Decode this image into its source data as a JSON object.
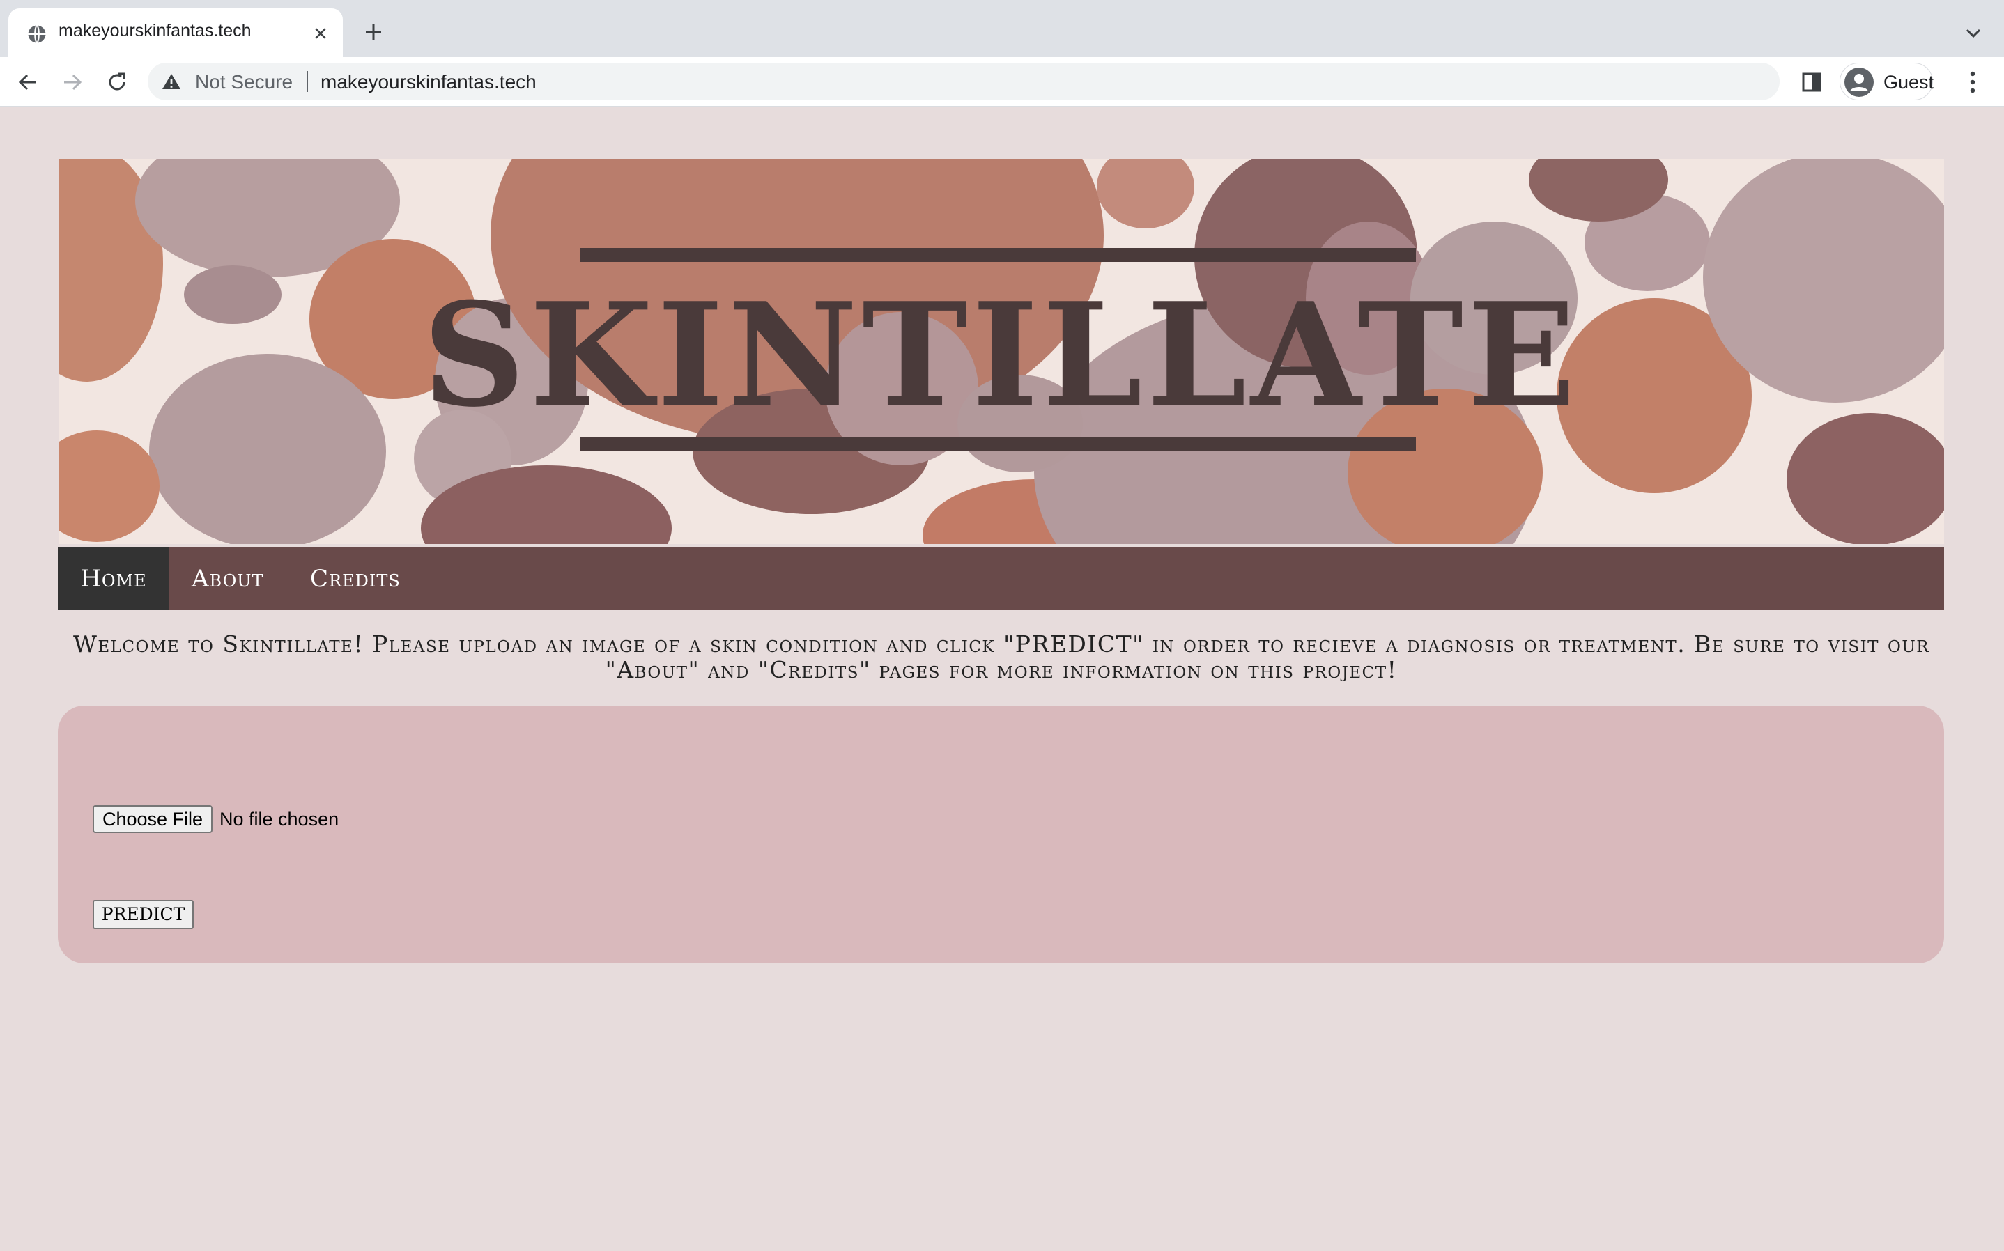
{
  "browser": {
    "tab_title": "makeyourskinfantas.tech",
    "security_label": "Not Secure",
    "url": "makeyourskinfantas.tech",
    "profile_name": "Guest"
  },
  "banner": {
    "logo_text": "SKINTILLATE"
  },
  "nav": {
    "items": [
      {
        "label": "Home",
        "active": true
      },
      {
        "label": "About",
        "active": false
      },
      {
        "label": "Credits",
        "active": false
      }
    ]
  },
  "welcome_text": "Welcome to Skintillate! Please upload an image of a skin condition and click \"PREDICT\" in order to recieve a diagnosis or treatment. Be sure to visit our \"About\" and \"Credits\" pages for more information on this project!",
  "upload": {
    "choose_file_label": "Choose File",
    "file_status": "No file chosen",
    "predict_label": "PREDICT"
  },
  "colors": {
    "page_bg": "#e7dcdc",
    "navbar": "#694a4a",
    "nav_active": "#333333",
    "upload_box": "#d9b9bc"
  }
}
